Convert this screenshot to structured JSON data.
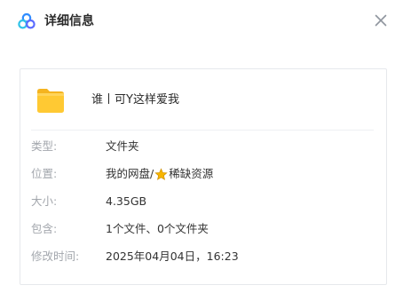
{
  "header": {
    "title": "详细信息",
    "app_icon": "baidu-netdisk-cloud-icon",
    "close_icon": "close-icon"
  },
  "file": {
    "icon": "folder-icon",
    "name": "谁丨可Y这样爱我"
  },
  "details": {
    "type_label": "类型:",
    "type_value": "文件夹",
    "location_label": "位置:",
    "location_prefix": "我的网盘/",
    "location_star_icon": "star-icon",
    "location_suffix": "稀缺资源",
    "size_label": "大小:",
    "size_value": "4.35GB",
    "contains_label": "包含:",
    "contains_value": "1个文件、0个文件夹",
    "modified_label": "修改时间:",
    "modified_value": "2025年04月04日，16:23"
  },
  "colors": {
    "folder": "#ffc933",
    "star": "#f7b500",
    "label": "#a3a7ad",
    "value": "#333333",
    "border": "#e6e8ec"
  }
}
